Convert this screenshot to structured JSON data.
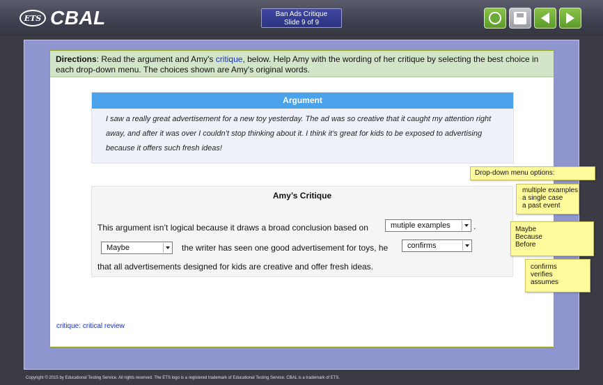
{
  "header": {
    "logo_badge": "ETS",
    "logo_text": "CBAL",
    "title_line1": "Ban Ads Critique",
    "title_line2": "Slide 9 of 9",
    "icons": [
      "circle-icon",
      "save-icon",
      "back-arrow-icon",
      "forward-arrow-icon"
    ]
  },
  "directions": {
    "label": "Directions",
    "text_before": ": Read the argument and Amy's ",
    "link": "critique",
    "text_after": ", below. Help Amy with the wording of her critique by selecting the best choice in each drop-down menu. The choices shown are Amy's original words."
  },
  "argument": {
    "heading": "Argument",
    "body": "I saw a really great advertisement for a new toy yesterday. The ad was so creative that it caught my attention right away, and after it was over I couldn’t stop thinking about it. I think it’s great for kids to be exposed to advertising because it offers such fresh ideas!"
  },
  "critique": {
    "heading": "Amy’s Critique",
    "line1": "This argument isn’t logical because it draws a broad conclusion based on",
    "dropdown1": "mutiple examples",
    "line1_end": ".",
    "dropdown2": "Maybe",
    "line2": "the writer has seen one good advertisement for toys, he",
    "dropdown3": "confirms",
    "line3": "that all advertisements designed for kids are creative and offer fresh ideas."
  },
  "footnote": "critique: critical review",
  "notes": {
    "header": "Drop-down menu options:",
    "options1": [
      "multiple examples",
      "a single case",
      "a past event"
    ],
    "options2": [
      "Maybe",
      "Because",
      "Before"
    ],
    "options3": [
      "confirms",
      "verifies",
      "assumes"
    ]
  },
  "copyright": "Copyright © 2015 by Educational Testing Service. All rights reserved. The ETS logo is a registered trademark of Educational Testing Service. CBAL is a trademark of ETS.",
  "colors": {
    "accent_blue": "#4aa2ea",
    "nav_green": "#6aa93a",
    "stage": "#8e95cf",
    "directions_bg": "#d3e5c9",
    "note_yellow": "#fffb9c"
  }
}
